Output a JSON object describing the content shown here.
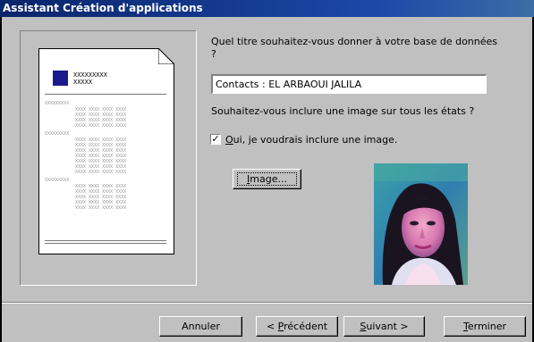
{
  "window": {
    "title": "Assistant Création d'applications"
  },
  "preview": {
    "header_line1": "XXXXXXXXX",
    "header_line2": "XXXXX",
    "section_label": "XXXXXXXXX",
    "row_text": "XXXX XXXX XXXX XXXX"
  },
  "form": {
    "question_title": "Quel titre souhaitez-vous donner à votre base de données ?",
    "title_value": "Contacts : EL ARBAOUI JALILA",
    "question_image": "Souhaitez-vous inclure une image sur tous les états ?",
    "include_image_checked": true,
    "include_image_label": "Oui, je voudrais inclure une image.",
    "image_button": "Image..."
  },
  "buttons": {
    "cancel": "Annuler",
    "previous": "< Précédent",
    "next": "Suivant >",
    "finish": "Terminer"
  },
  "colors": {
    "titlebar": "#0a246a",
    "face": "#c0c0c0",
    "logo": "#1a1a8c"
  }
}
